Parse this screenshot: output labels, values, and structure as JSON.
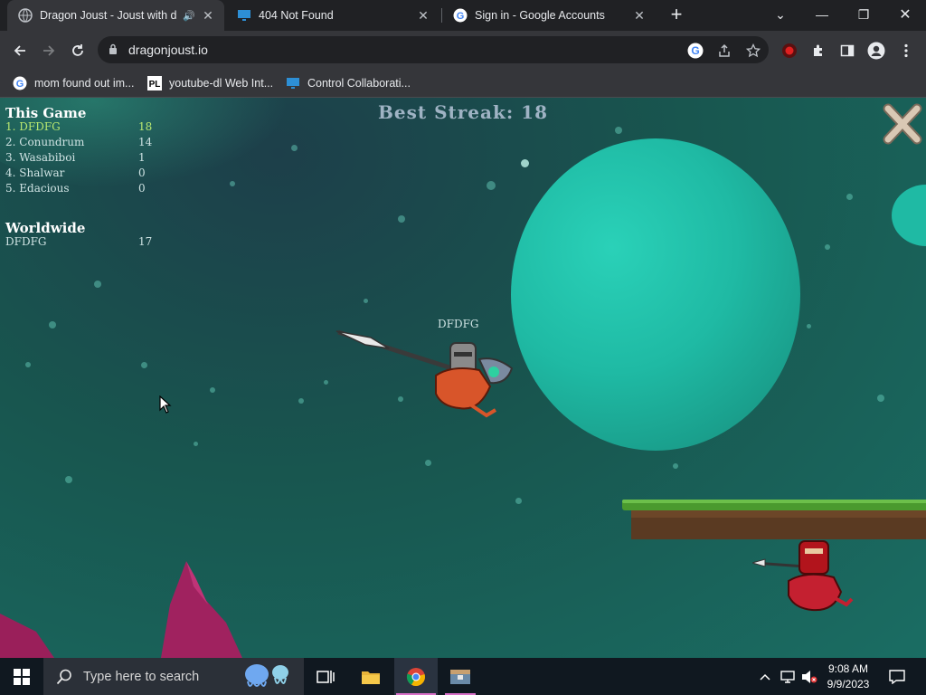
{
  "browser": {
    "tabs": [
      {
        "title": "Dragon Joust - Joust with dr",
        "active": true,
        "audio": true
      },
      {
        "title": "404 Not Found",
        "active": false
      },
      {
        "title": "Sign in - Google Accounts",
        "active": false
      }
    ],
    "url": "dragonjoust.io",
    "bookmarks": [
      {
        "label": "mom found out im..."
      },
      {
        "label": "youtube-dl Web Int..."
      },
      {
        "label": "Control Collaborati..."
      }
    ]
  },
  "game": {
    "this_game_title": "This Game",
    "this_game": [
      {
        "rank_name": "1. DFDFG",
        "score": "18"
      },
      {
        "rank_name": "2. Conundrum",
        "score": "14"
      },
      {
        "rank_name": "3. Wasabiboi",
        "score": "1"
      },
      {
        "rank_name": "4. Shalwar",
        "score": "0"
      },
      {
        "rank_name": "5. Edacious",
        "score": "0"
      }
    ],
    "worldwide_title": "Worldwide",
    "worldwide": [
      {
        "name": "DFDFG",
        "score": "17"
      }
    ],
    "best_streak": "Best Streak: 18",
    "player_label": "DFDFG",
    "colors": {
      "sky": "#18564f",
      "planet": "#1fbaa4",
      "grass": "#4a9a2e",
      "dirt": "#5a3a22"
    }
  },
  "taskbar": {
    "search_placeholder": "Type here to search",
    "time": "9:08 AM",
    "date": "9/9/2023"
  }
}
